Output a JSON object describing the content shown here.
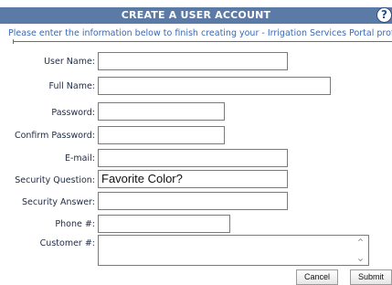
{
  "header": {
    "title": "CREATE A USER ACCOUNT",
    "help_icon": "?"
  },
  "instructions": "Please enter the information below to finish creating your - Irrigation Services Portal profile.",
  "form": {
    "user_name": {
      "label": "User Name:",
      "value": ""
    },
    "full_name": {
      "label": "Full Name:",
      "value": ""
    },
    "password": {
      "label": "Password:",
      "value": ""
    },
    "confirm_password": {
      "label": "Confirm Password:",
      "value": ""
    },
    "email": {
      "label": "E-mail:",
      "value": ""
    },
    "security_question": {
      "label": "Security Question:",
      "value": "Favorite Color?"
    },
    "security_answer": {
      "label": "Security Answer:",
      "value": ""
    },
    "phone": {
      "label": "Phone #:",
      "value": ""
    },
    "customer": {
      "label": "Customer #:",
      "value": ""
    }
  },
  "buttons": {
    "cancel": "Cancel",
    "submit": "Submit"
  }
}
